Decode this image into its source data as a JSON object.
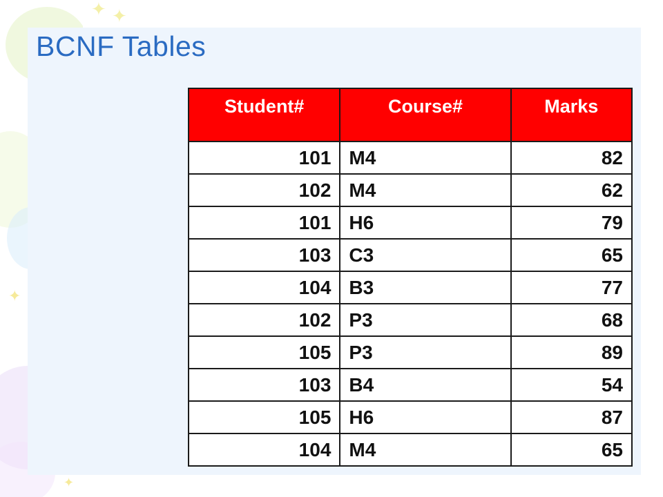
{
  "slide": {
    "title": "BCNF Tables"
  },
  "table": {
    "headers": [
      "Student#",
      "Course#",
      "Marks"
    ],
    "rows": [
      [
        "101",
        "M4",
        "82"
      ],
      [
        "102",
        "M4",
        "62"
      ],
      [
        "101",
        "H6",
        "79"
      ],
      [
        "103",
        "C3",
        "65"
      ],
      [
        "104",
        "B3",
        "77"
      ],
      [
        "102",
        "P3",
        "68"
      ],
      [
        "105",
        "P3",
        "89"
      ],
      [
        "103",
        "B4",
        "54"
      ],
      [
        "105",
        "H6",
        "87"
      ],
      [
        "104",
        "M4",
        "65"
      ]
    ]
  },
  "colors": {
    "title": "#2a6bc2",
    "header_background": "#ff0000",
    "header_text": "#ffffff",
    "panel_background": "#eef5fd"
  }
}
